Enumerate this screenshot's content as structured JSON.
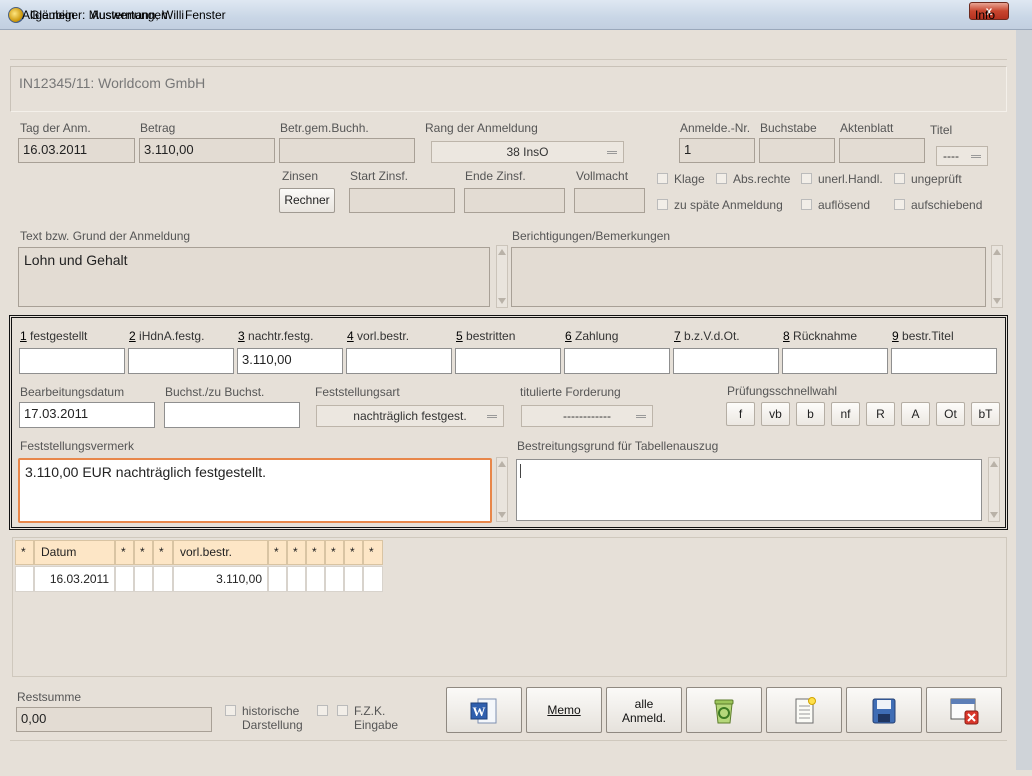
{
  "window": {
    "title": "Gläubiger: Mustermann, Willi",
    "close": "x"
  },
  "menu": {
    "items": [
      "Allgemein",
      "Auswertungen",
      "Fenster"
    ],
    "info": "Info"
  },
  "case": {
    "title": "IN12345/11: Worldcom GmbH"
  },
  "anmeldung": {
    "tag_label": "Tag der Anm.",
    "tag": "16.03.2011",
    "betrag_label": "Betrag",
    "betrag": "3.110,00",
    "betr_gem_label": "Betr.gem.Buchh.",
    "betr_gem": "",
    "rang_label": "Rang der Anmeldung",
    "rang": "38 InsO",
    "anmelde_nr_label": "Anmelde.-Nr.",
    "anmelde_nr": "1",
    "buchstabe_label": "Buchstabe",
    "buchstabe": "",
    "aktenblatt_label": "Aktenblatt",
    "aktenblatt": "",
    "titel_label": "Titel",
    "titel": "----",
    "zinsen_label": "Zinsen",
    "rechner": "Rechner",
    "start_zinsf_label": "Start Zinsf.",
    "ende_zinsf_label": "Ende Zinsf.",
    "vollmacht_label": "Vollmacht",
    "checks": [
      "Klage",
      "Abs.rechte",
      "unerl.Handl.",
      "ungeprüft",
      "zu späte Anmeldung",
      "auflösend",
      "aufschiebend"
    ],
    "text_label": "Text bzw. Grund der Anmeldung",
    "text": "Lohn und Gehalt",
    "bericht_label": "Berichtigungen/Bemerkungen",
    "bericht": ""
  },
  "fest": {
    "cols": [
      {
        "num": "1",
        "label": "festgestellt",
        "value": ""
      },
      {
        "num": "2",
        "label": "iHdnA.festg.",
        "value": ""
      },
      {
        "num": "3",
        "label": "nachtr.festg.",
        "value": "3.110,00"
      },
      {
        "num": "4",
        "label": "vorl.bestr.",
        "value": ""
      },
      {
        "num": "5",
        "label": "bestritten",
        "value": ""
      },
      {
        "num": "6",
        "label": "Zahlung",
        "value": ""
      },
      {
        "num": "7",
        "label": "b.z.V.d.Ot.",
        "value": ""
      },
      {
        "num": "8",
        "label": "Rücknahme",
        "value": ""
      },
      {
        "num": "9",
        "label": "bestr.Titel",
        "value": ""
      }
    ],
    "bearb_label": "Bearbeitungsdatum",
    "bearb": "17.03.2011",
    "buchst_label": "Buchst./zu Buchst.",
    "buchst": "",
    "art_label": "Feststellungsart",
    "art": "nachträglich festgest.",
    "tit_label": "titulierte Forderung",
    "tit": "------------",
    "pruef_label": "Prüfungsschnellwahl",
    "pruef": [
      "f",
      "vb",
      "b",
      "nf",
      "R",
      "A",
      "Ot",
      "bT"
    ],
    "vermerk_label": "Feststellungsvermerk",
    "vermerk": "3.110,00 EUR nachträglich festgestellt.",
    "befreiung_label": "Bestreitungsgrund für Tabellenauszug",
    "befreiung": ""
  },
  "table": {
    "headers": [
      "*",
      "Datum",
      "*",
      "*",
      "*",
      "vorl.bestr.",
      "*",
      "*",
      "*",
      "*",
      "*",
      "*"
    ],
    "row": [
      "",
      "16.03.2011",
      "",
      "",
      "",
      "3.110,00",
      "",
      "",
      "",
      "",
      "",
      ""
    ]
  },
  "bottom": {
    "rest_label": "Restsumme",
    "rest": "0,00",
    "hist1": "historische",
    "hist2": "Darstellung",
    "fzk1": "F.Z.K.",
    "fzk2": "Eingabe",
    "memo": "Memo",
    "alle1": "alle",
    "alle2": "Anmeld."
  }
}
